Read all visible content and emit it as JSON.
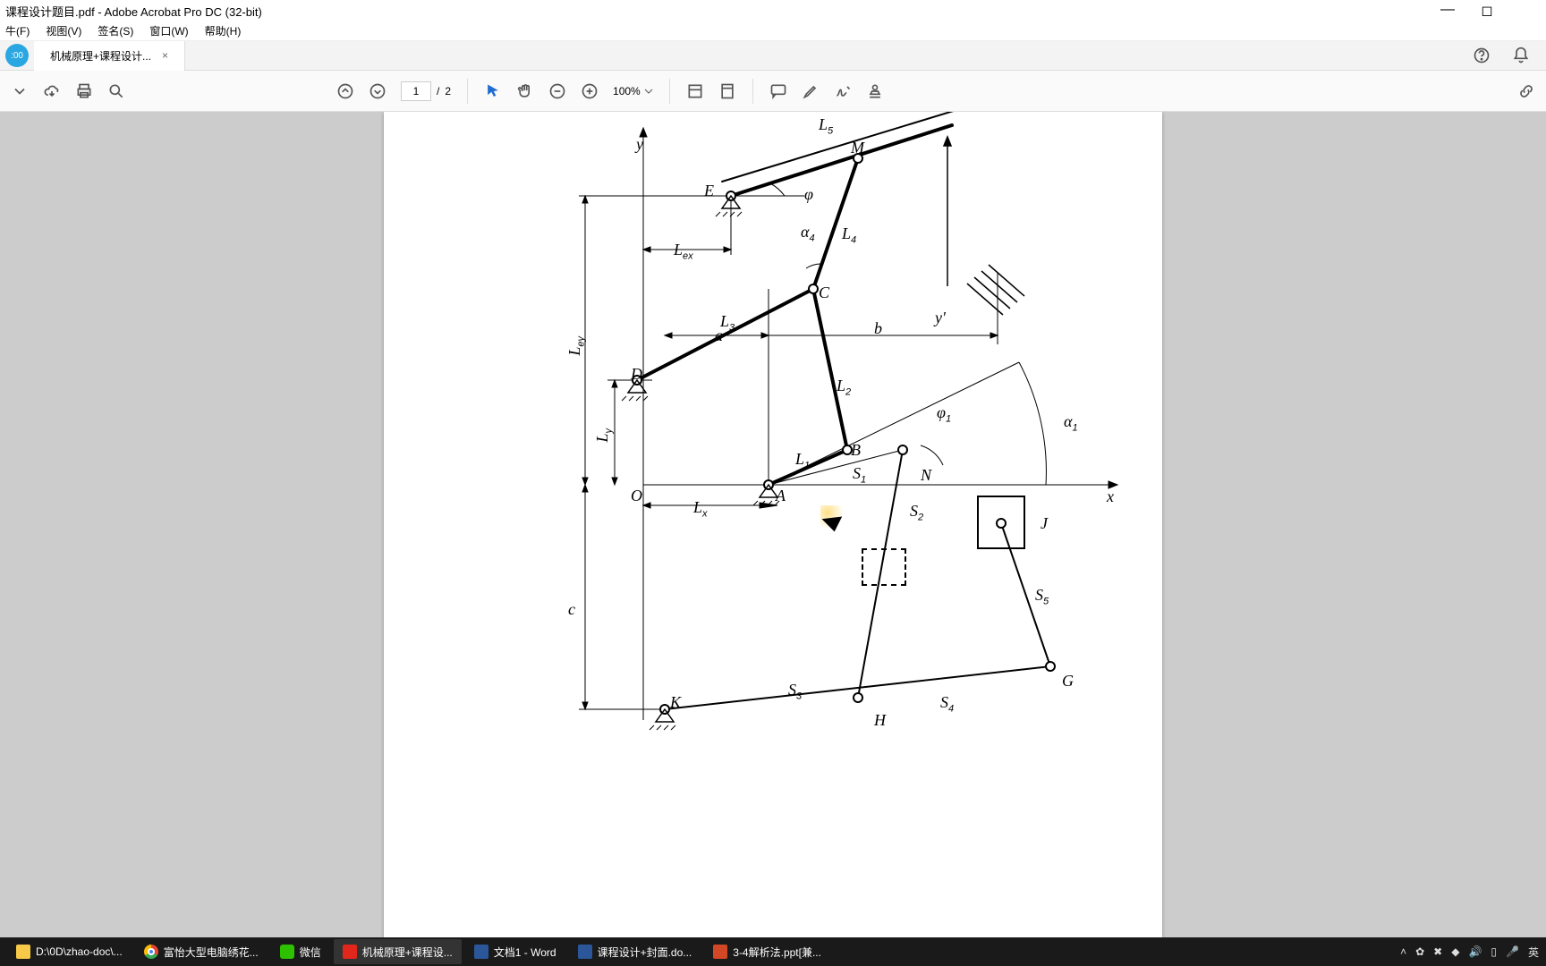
{
  "window": {
    "title": "课程设计题目.pdf - Adobe Acrobat Pro DC (32-bit)"
  },
  "menubar": {
    "file_trunc": "牛(F)",
    "view": "视图(V)",
    "sign": "签名(S)",
    "window": "窗口(W)",
    "help": "帮助(H)"
  },
  "tabstrip": {
    "home_badge": ":00",
    "tab_title": "机械原理+课程设计...",
    "tab_close": "×"
  },
  "toolbar": {
    "page_current": "1",
    "page_sep": "/",
    "page_total": "2",
    "zoom": "100%"
  },
  "diagram_labels": {
    "y_axis": "y",
    "x_axis": "x",
    "O": "O",
    "A": "A",
    "B": "B",
    "C": "C",
    "D": "D",
    "E": "E",
    "G": "G",
    "H": "H",
    "J": "J",
    "K": "K",
    "M": "M",
    "N": "N",
    "L1": "L<span class='sub'>1</span>",
    "L2": "L<span class='sub'>2</span>",
    "L3": "L<span class='sub'>3</span>",
    "L4": "L<span class='sub'>4</span>",
    "L5": "L<span class='sub'>5</span>",
    "Lx": "L<span class='sub'>x</span>",
    "Ly": "L<span class='sub'>y</span>",
    "Lex": "L<span class='sub'>ex</span>",
    "Ley": "L<span class='sub'>ey</span>",
    "S1": "S<span class='sub'>1</span>",
    "S2": "S<span class='sub'>2</span>",
    "S3": "S<span class='sub'>3</span>",
    "S4": "S<span class='sub'>4</span>",
    "S5": "S<span class='sub'>5</span>",
    "a": "a",
    "b": "b",
    "c": "c",
    "phi": "φ",
    "phi1": "φ<span class='sub'>1</span>",
    "alpha1": "α<span class='sub'>1</span>",
    "alpha4": "α<span class='sub'>4</span>",
    "hatch_y_prime": "y'"
  },
  "taskbar": {
    "items": [
      {
        "icon": "folder",
        "label": "D:\\0D\\zhao-doc\\..."
      },
      {
        "icon": "chrome",
        "label": "富怡大型电脑绣花..."
      },
      {
        "icon": "wechat",
        "label": "微信"
      },
      {
        "icon": "pdf",
        "label": "机械原理+课程设..."
      },
      {
        "icon": "word",
        "label": "文档1 - Word"
      },
      {
        "icon": "word",
        "label": "课程设计+封面.do..."
      },
      {
        "icon": "ppt",
        "label": "3-4解析法.ppt[兼..."
      }
    ],
    "ime": "英"
  }
}
